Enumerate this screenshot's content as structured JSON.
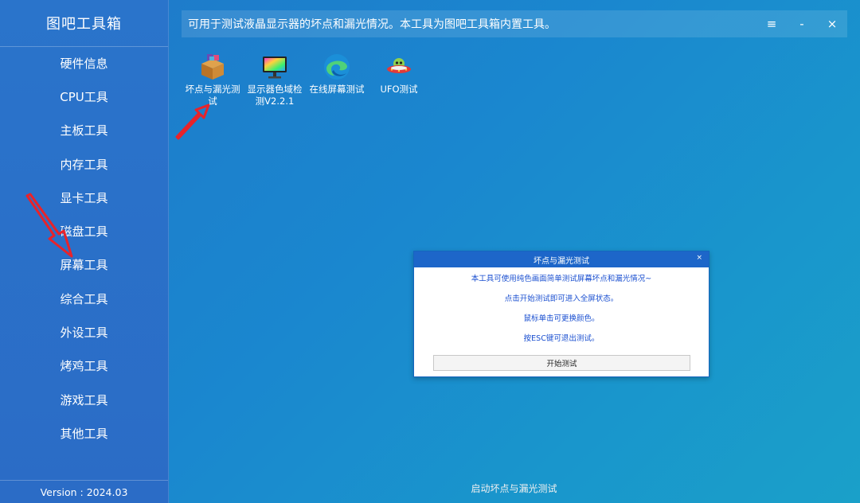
{
  "app": {
    "title": "图吧工具箱",
    "version": "Version : 2024.03"
  },
  "sidebar": {
    "items": [
      {
        "label": "硬件信息"
      },
      {
        "label": "CPU工具"
      },
      {
        "label": "主板工具"
      },
      {
        "label": "内存工具"
      },
      {
        "label": "显卡工具"
      },
      {
        "label": "磁盘工具"
      },
      {
        "label": "屏幕工具"
      },
      {
        "label": "综合工具"
      },
      {
        "label": "外设工具"
      },
      {
        "label": "烤鸡工具"
      },
      {
        "label": "游戏工具"
      },
      {
        "label": "其他工具"
      }
    ]
  },
  "header": {
    "description": "可用于测试液晶显示器的坏点和漏光情况。本工具为图吧工具箱内置工具。",
    "menu_icon": "≡",
    "minimize_icon": "-",
    "close_icon": "×"
  },
  "tools": [
    {
      "label": "坏点与漏光测试",
      "icon": "package-icon"
    },
    {
      "label": "显示器色域检测V2.2.1",
      "icon": "monitor-icon"
    },
    {
      "label": "在线屏幕测试",
      "icon": "edge-browser-icon"
    },
    {
      "label": "UFO测试",
      "icon": "ufo-icon"
    }
  ],
  "dialog": {
    "title": "坏点与漏光测试",
    "close": "×",
    "lines": [
      "本工具可使用纯色画面简单测试屏幕坏点和漏光情况~",
      "点击开始测试即可进入全屏状态。",
      "鼠标单击可更换颜色。",
      "按ESC键可退出测试。"
    ],
    "button": "开始测试"
  },
  "status": "启动坏点与漏光测试",
  "colors": {
    "accent": "#1d66c9",
    "dialog_text": "#1a4fd0",
    "arrow": "#e8232a"
  }
}
